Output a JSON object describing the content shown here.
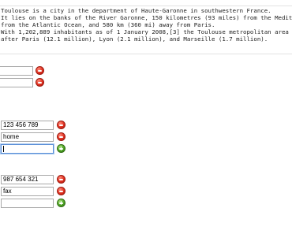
{
  "description_text": {
    "lines": [
      "Toulouse is a city in the department of Haute-Garonne in southwestern France.",
      "It lies on the banks of the River Garonne, 150 kilometres (93 miles) from the Mediterranean",
      "from the Atlantic Ocean, and 580 km (360 mi) away from Paris.",
      "With 1,202,889 inhabitants as of 1 January 2008,[3] the Toulouse metropolitan area is the fo",
      "after Paris (12.1 million), Lyon (2.1 million), and Marseille (1.7 million)."
    ]
  },
  "group1": {
    "fields": [
      {
        "value": ""
      },
      {
        "value": ""
      }
    ]
  },
  "group2": {
    "fields": [
      {
        "value": "123 456 789"
      },
      {
        "value": "home"
      },
      {
        "value": ""
      }
    ]
  },
  "group3": {
    "fields": [
      {
        "value": "987 654 321"
      },
      {
        "value": "fax"
      },
      {
        "value": ""
      }
    ]
  },
  "colors": {
    "remove_button": "#e0301f",
    "add_button": "#4fa524",
    "focus_border": "#5b8fd6"
  },
  "icons": {
    "remove": "minus-circle-icon",
    "add": "plus-circle-icon"
  }
}
